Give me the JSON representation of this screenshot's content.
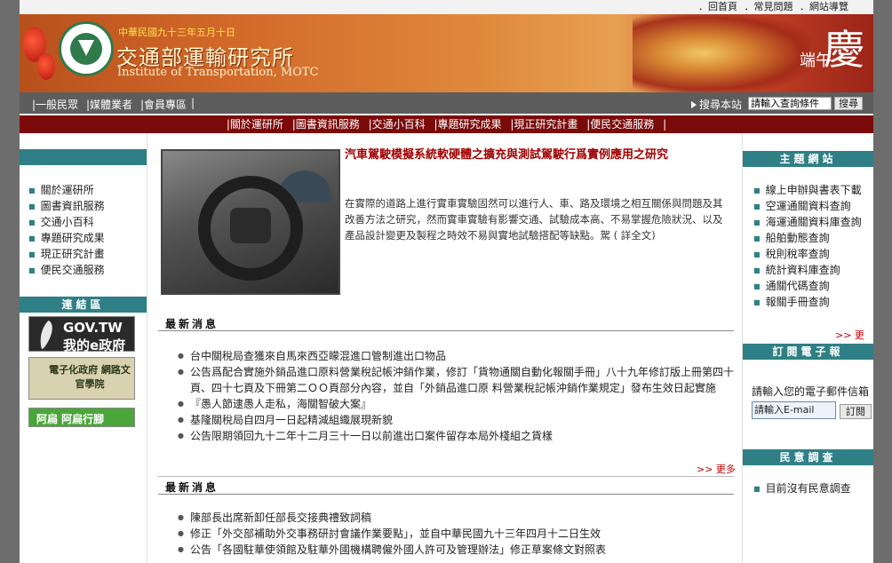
{
  "top_links": [
    "．回首頁",
    "．常見問題",
    "．網站導覽"
  ],
  "banner": {
    "date": "中華民國九十三年五月十日",
    "org_name": "交通部運輸研究所",
    "org_name_en": "Institute of Transportation, MOTC",
    "festival_big": "慶",
    "festival_small": "端午"
  },
  "nav": {
    "links": [
      "|一般民眾",
      "|媒體業者",
      "|會員專區",
      "|"
    ],
    "search_label": "搜尋本站",
    "search_value": "請輸入查詢條件",
    "search_button": "搜尋"
  },
  "menu": [
    "|關於運研所",
    "|圖書資訊服務",
    "|交通小百科",
    "|專題研究成果",
    "|現正研究計畫",
    "|便民交通服務",
    "|"
  ],
  "left": {
    "items": [
      "關於運研所",
      "圖書資訊服務",
      "交通小百科",
      "專題研究成果",
      "現正研究計畫",
      "便民交通服務"
    ],
    "links_title": "連結區",
    "badges": [
      "GOV.TW 我的e政府",
      "電子化政府 網路文官學院",
      "阿扁 阿扁行腳"
    ]
  },
  "feature": {
    "title": "汽車駕駛模擬系統軟硬體之擴充與測試駕駛行爲實例應用之研究",
    "body": "在實際的道路上進行實車實驗固然可以進行人、車、路及環境之相互關係與問題及其改善方法之研究，然而實車實驗有影響交通、試驗成本高、不易掌握危險狀況、以及產品設計變更及製程之時效不易與實地試驗搭配等缺點。駕 ( 詳全文)"
  },
  "news1": {
    "title": "最新消息",
    "items": [
      "台中關稅局查獲來自馬來西亞矇混進口管制進出口物品",
      "公告爲配合實施外銷品進口原料營業稅記帳沖銷作業，修訂「貨物通關自動化報關手冊」八十九年修訂版上冊第四十頁、四十七頁及下冊第二ＯＯ頁部分內容，並自「外銷品進口原 料營業稅記帳沖銷作業規定」發布生效日起實施",
      "『愚人節逮愚人走私，海關智破大案』",
      "基隆關稅局自四月一日起精減組織展現新貌",
      "公告限期領回九十二年十二月三十一日以前進出口案件留存本局外棧組之貨樣"
    ],
    "more": ">> 更多"
  },
  "news2": {
    "title": "最新消息",
    "items": [
      "陳部長出席新卸任部長交接典禮致詞稿",
      "修正「外交部補助外交事務研討會議作業要點」，並自中華民國九十三年四月十二日生效",
      "公告「各國駐華使領館及駐華外國機構聘僱外國人許可及管理辦法」修正草案條文對照表"
    ]
  },
  "right": {
    "topic_title": "主題網站",
    "topic_items": [
      "線上申辦與書表下載",
      "空運通關資料查詢",
      "海運通關資料庫查詢",
      "船舶動態查詢",
      "稅則稅率查詢",
      "統計資料庫查詢",
      "通關代碼查詢",
      "報關手冊查詢"
    ],
    "more": ">> 更多",
    "subscribe_title": "訂閱電子報",
    "subscribe_label": "請輸入您的電子郵件信箱",
    "email_placeholder": "請輸入E-mail",
    "subscribe_button": "訂閱",
    "poll_title": "民意調查",
    "poll_items": [
      "目前沒有民意調查"
    ]
  }
}
